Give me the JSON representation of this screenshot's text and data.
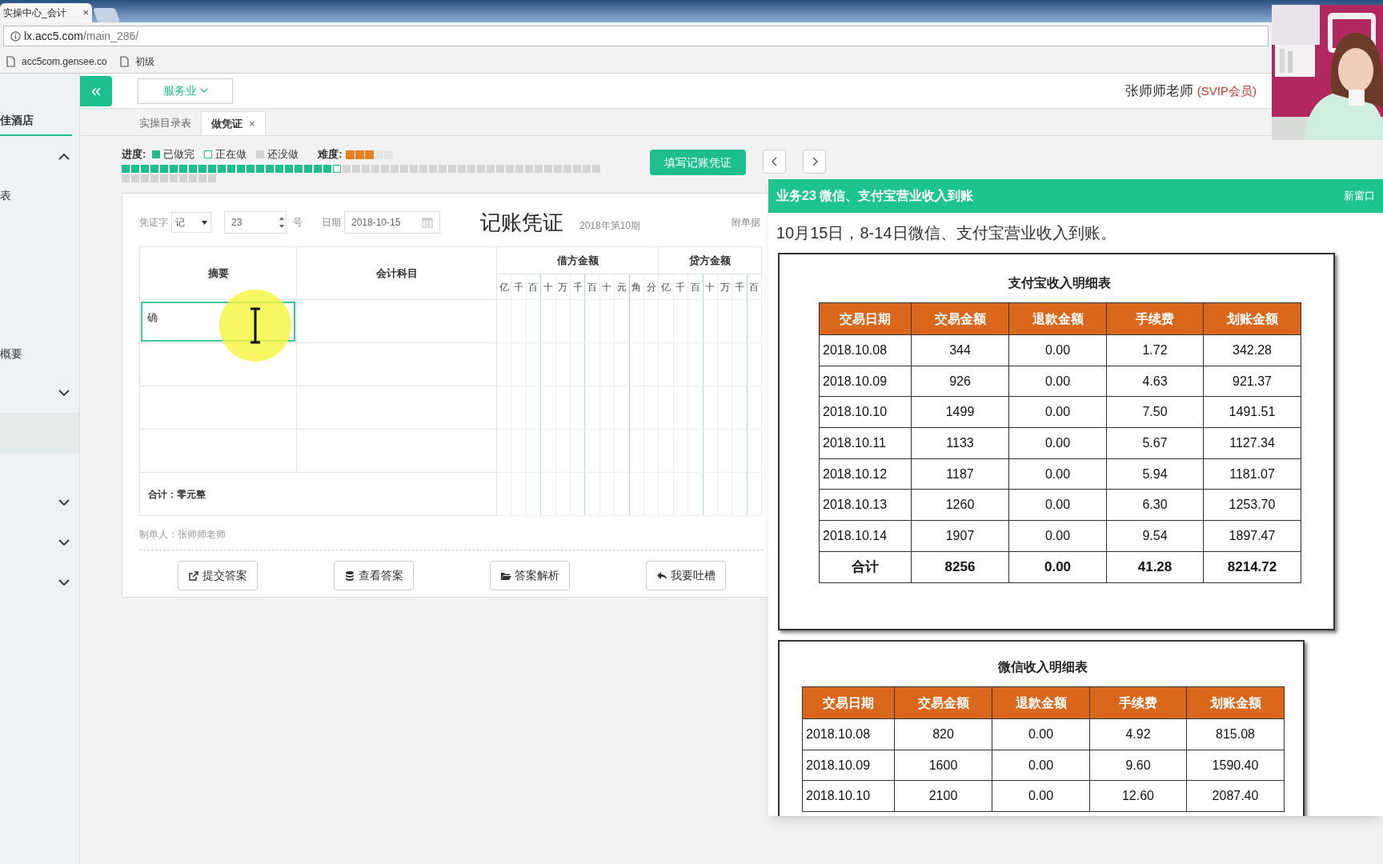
{
  "browser": {
    "tab": {
      "title": "实操中心_会计",
      "close": "×"
    },
    "address": {
      "host": "lx.acc5.com",
      "path": "/main_286/"
    },
    "bookmarks": [
      "acc5com.gensee.co",
      "初级"
    ]
  },
  "sidebar": {
    "items": [
      {
        "kind": "title",
        "label": "佳酒店"
      },
      {
        "kind": "toggle",
        "expanded": true
      },
      {
        "kind": "label",
        "label": "表"
      },
      {
        "kind": "label",
        "label": "概要"
      },
      {
        "kind": "toggle",
        "expanded": false
      },
      {
        "kind": "row",
        "selected": true
      },
      {
        "kind": "toggle",
        "expanded": false
      },
      {
        "kind": "toggle",
        "expanded": false
      },
      {
        "kind": "toggle",
        "expanded": false
      }
    ]
  },
  "header": {
    "collapse": "«",
    "dropdown": "服务业",
    "user": "张师师老师",
    "badge": "(SVIP会员)"
  },
  "tabs": [
    {
      "label": "实操目录表",
      "selected": false
    },
    {
      "label": "做凭证",
      "selected": true,
      "close": "×"
    }
  ],
  "progress": {
    "label": "进度:",
    "legend": [
      {
        "label": "已做完",
        "kind": "done"
      },
      {
        "label": "正在做",
        "kind": "current"
      },
      {
        "label": "还没做",
        "kind": "todo"
      }
    ],
    "segments": [
      {
        "kind": "done"
      },
      {
        "kind": "done"
      },
      {
        "kind": "done"
      },
      {
        "kind": "done"
      },
      {
        "kind": "done"
      },
      {
        "kind": "done"
      },
      {
        "kind": "done"
      },
      {
        "kind": "done"
      },
      {
        "kind": "done"
      },
      {
        "kind": "done"
      },
      {
        "kind": "done"
      },
      {
        "kind": "done"
      },
      {
        "kind": "done"
      },
      {
        "kind": "done"
      },
      {
        "kind": "done"
      },
      {
        "kind": "done"
      },
      {
        "kind": "done"
      },
      {
        "kind": "done"
      },
      {
        "kind": "done"
      },
      {
        "kind": "done"
      },
      {
        "kind": "done"
      },
      {
        "kind": "done"
      },
      {
        "kind": "current"
      },
      {
        "kind": "todo"
      },
      {
        "kind": "todo"
      },
      {
        "kind": "todo"
      },
      {
        "kind": "todo"
      },
      {
        "kind": "todo"
      },
      {
        "kind": "todo"
      },
      {
        "kind": "todo"
      },
      {
        "kind": "todo"
      },
      {
        "kind": "todo"
      },
      {
        "kind": "todo"
      },
      {
        "kind": "todo"
      },
      {
        "kind": "todo"
      },
      {
        "kind": "todo"
      },
      {
        "kind": "todo"
      },
      {
        "kind": "todo"
      },
      {
        "kind": "todo"
      },
      {
        "kind": "todo"
      },
      {
        "kind": "todo"
      },
      {
        "kind": "todo"
      },
      {
        "kind": "todo"
      },
      {
        "kind": "todo"
      },
      {
        "kind": "todo"
      },
      {
        "kind": "todo"
      },
      {
        "kind": "todo"
      },
      {
        "kind": "todo"
      },
      {
        "kind": "todo"
      },
      {
        "kind": "todo"
      },
      {
        "kind": "todo"
      },
      {
        "kind": "todo"
      },
      {
        "kind": "todo"
      },
      {
        "kind": "todo"
      },
      {
        "kind": "todo"
      },
      {
        "kind": "todo"
      },
      {
        "kind": "todo"
      },
      {
        "kind": "todo"
      },
      {
        "kind": "todo"
      },
      {
        "kind": "todo"
      }
    ],
    "difficulty_label": "难度:",
    "stars": 3
  },
  "fill_button": "填写记账凭证",
  "voucher": {
    "word_label": "凭证字",
    "word": "记",
    "number": "23",
    "number_suffix": "号",
    "date_label": "日期",
    "date": "2018-10-15",
    "title": "记账凭证",
    "period": "2018年第10期",
    "attach_label": "附单据",
    "columns": [
      "摘要",
      "会计科目"
    ],
    "debit": "借方金额",
    "credit": "贷方金额",
    "debit_digits": [
      "亿",
      "千",
      "百",
      "十",
      "万",
      "千",
      "百",
      "十",
      "元",
      "角",
      "分"
    ],
    "credit_digits": [
      "亿",
      "千",
      "百",
      "十",
      "万",
      "千",
      "百"
    ],
    "rows": [
      {
        "summary": "确",
        "focused": true
      },
      {
        "focused": false
      },
      {
        "focused": false
      },
      {
        "focused": false
      }
    ],
    "total": "合计：零元整",
    "maker": "制单人：张师师老师",
    "buttons": [
      {
        "kind": "submit",
        "label": "提交答案"
      },
      {
        "kind": "view",
        "label": "查看答案"
      },
      {
        "kind": "explain",
        "label": "答案解析"
      },
      {
        "kind": "feedback",
        "label": "我要吐槽"
      }
    ]
  },
  "task_panel": {
    "title": "业务23 微信、支付宝营业收入到账",
    "new_window": "新窗口",
    "description": "10月15日，8-14日微信、支付宝营业收入到账。",
    "tables": [
      {
        "title": "支付宝收入明细表",
        "columns": [
          "交易日期",
          "交易金额",
          "退款金额",
          "手续费",
          "划账金额"
        ],
        "rows": [
          [
            "2018.10.08",
            "344",
            "0.00",
            "1.72",
            "342.28"
          ],
          [
            "2018.10.09",
            "926",
            "0.00",
            "4.63",
            "921.37"
          ],
          [
            "2018.10.10",
            "1499",
            "0.00",
            "7.50",
            "1491.51"
          ],
          [
            "2018.10.11",
            "1133",
            "0.00",
            "5.67",
            "1127.34"
          ],
          [
            "2018.10.12",
            "1187",
            "0.00",
            "5.94",
            "1181.07"
          ],
          [
            "2018.10.13",
            "1260",
            "0.00",
            "6.30",
            "1253.70"
          ],
          [
            "2018.10.14",
            "1907",
            "0.00",
            "9.54",
            "1897.47"
          ]
        ],
        "total": [
          "合计",
          "8256",
          "0.00",
          "41.28",
          "8214.72"
        ]
      },
      {
        "title": "微信收入明细表",
        "columns": [
          "交易日期",
          "交易金额",
          "退款金额",
          "手续费",
          "划账金额"
        ],
        "rows": [
          [
            "2018.10.08",
            "820",
            "0.00",
            "4.92",
            "815.08"
          ],
          [
            "2018.10.09",
            "1600",
            "0.00",
            "9.60",
            "1590.40"
          ],
          [
            "2018.10.10",
            "2100",
            "0.00",
            "12.60",
            "2087.40"
          ]
        ]
      }
    ]
  }
}
